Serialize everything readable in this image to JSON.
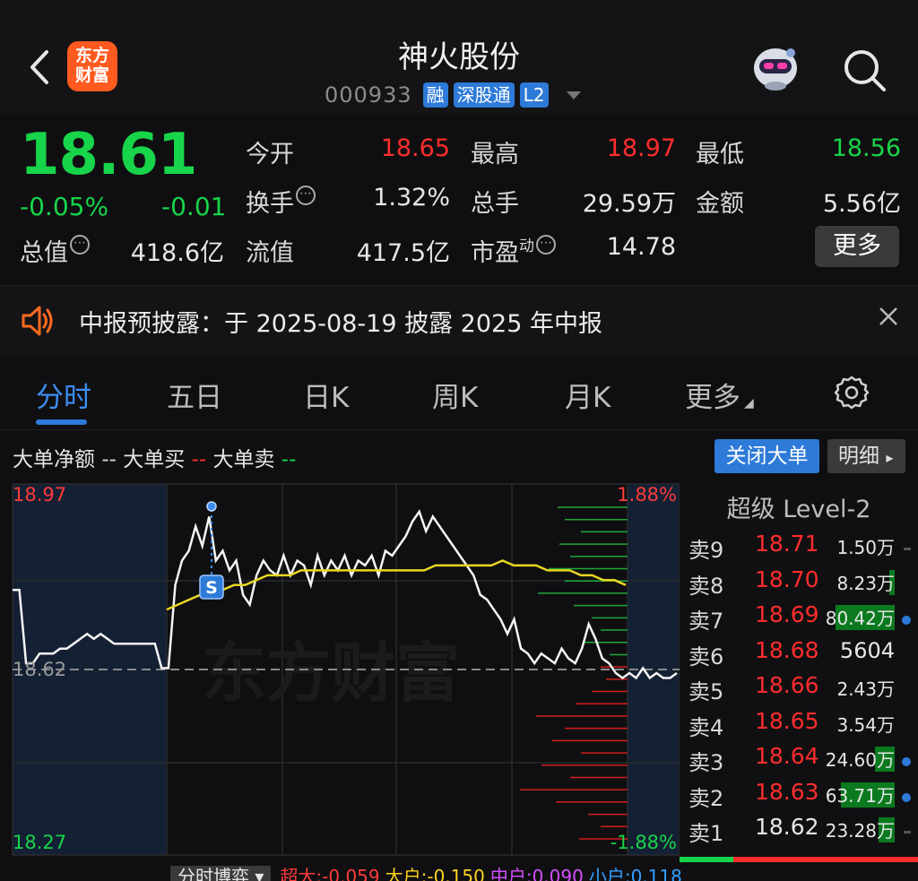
{
  "header": {
    "title": "神火股份",
    "logo_text_1": "东方",
    "logo_text_2": "财富",
    "code": "000933",
    "tags": [
      "融",
      "深股通",
      "L2"
    ]
  },
  "quote": {
    "price": "18.61",
    "change_pct": "-0.05%",
    "change": "-0.01",
    "stats": [
      {
        "label": "今开",
        "value": "18.65",
        "color": "up"
      },
      {
        "label": "最高",
        "value": "18.97",
        "color": "up"
      },
      {
        "label": "最低",
        "value": "18.56",
        "color": "down"
      },
      {
        "label": "换手",
        "value": "1.32%",
        "color": "plain"
      },
      {
        "label": "总手",
        "value": "29.59万",
        "color": "plain"
      },
      {
        "label": "金额",
        "value": "5.56亿",
        "color": "plain"
      },
      {
        "label": "总值",
        "value": "418.6亿",
        "color": "plain"
      },
      {
        "label": "流值",
        "value": "417.5亿",
        "color": "plain"
      },
      {
        "label": "市盈",
        "label_sup": "动",
        "value": "14.78",
        "color": "plain"
      }
    ],
    "more_label": "更多",
    "info_glyph": "⋯"
  },
  "notice": {
    "text": "中报预披露：于 2025-08-19 披露 2025 年中报"
  },
  "tabs": [
    {
      "label": "分时",
      "active": true
    },
    {
      "label": "五日"
    },
    {
      "label": "日K"
    },
    {
      "label": "周K"
    },
    {
      "label": "月K"
    },
    {
      "label": "更多"
    }
  ],
  "legend": {
    "net_label": "大单净额",
    "net_marker": "--",
    "buy_label": "大单买",
    "buy_marker": "--",
    "sell_label": "大单卖",
    "sell_marker": "--",
    "close_button": "关闭大单",
    "detail_button": "明细",
    "detail_arrow": "▸"
  },
  "chart_data": {
    "type": "line",
    "price_high_label": "18.97",
    "price_ref_label": "18.62",
    "price_low_label": "18.27",
    "pct_high_label": "1.88%",
    "pct_low_label": "-1.88%",
    "watermark": "东方财富",
    "signal_label": "S",
    "ylim": [
      18.27,
      18.97
    ],
    "ref_price": 18.62,
    "price_series": [
      18.79,
      18.79,
      18.64,
      18.64,
      18.66,
      18.66,
      18.66,
      18.67,
      18.67,
      18.68,
      18.69,
      18.7,
      18.69,
      18.7,
      18.69,
      18.68,
      18.68,
      18.68,
      18.68,
      18.68,
      18.68,
      18.68,
      18.63,
      18.63,
      18.8,
      18.85,
      18.87,
      18.92,
      18.88,
      18.94,
      18.85,
      18.87,
      18.83,
      18.85,
      18.78,
      18.76,
      18.82,
      18.85,
      18.83,
      18.82,
      18.86,
      18.82,
      18.85,
      18.84,
      18.8,
      18.86,
      18.82,
      18.85,
      18.83,
      18.86,
      18.82,
      18.85,
      18.84,
      18.86,
      18.82,
      18.87,
      18.86,
      18.88,
      18.9,
      18.93,
      18.95,
      18.91,
      18.94,
      18.92,
      18.9,
      18.88,
      18.86,
      18.84,
      18.82,
      18.78,
      18.77,
      18.75,
      18.73,
      18.7,
      18.73,
      18.67,
      18.66,
      18.64,
      18.66,
      18.65,
      18.64,
      18.67,
      18.65,
      18.64,
      18.67,
      18.72,
      18.69,
      18.65,
      18.64,
      18.62,
      18.61,
      18.62,
      18.61,
      18.63,
      18.61,
      18.62,
      18.61,
      18.61,
      18.62
    ],
    "avg_series": [
      18.75,
      18.76,
      18.77,
      18.78,
      18.79,
      18.79,
      18.8,
      18.8,
      18.81,
      18.82,
      18.82,
      18.82,
      18.83,
      18.83,
      18.83,
      18.83,
      18.83,
      18.83,
      18.83,
      18.83,
      18.83,
      18.83,
      18.83,
      18.83,
      18.84,
      18.84,
      18.84,
      18.84,
      18.84,
      18.84,
      18.85,
      18.84,
      18.84,
      18.84,
      18.83,
      18.83,
      18.83,
      18.82,
      18.82,
      18.81,
      18.81,
      18.8
    ],
    "big_order_ladder": [
      {
        "side": "buy",
        "len": 78
      },
      {
        "side": "buy",
        "len": 70
      },
      {
        "side": "buy",
        "len": 52
      },
      {
        "side": "buy",
        "len": 76
      },
      {
        "side": "buy",
        "len": 64
      },
      {
        "side": "buy",
        "len": 88
      },
      {
        "side": "buy",
        "len": 70
      },
      {
        "side": "buy",
        "len": 100
      },
      {
        "side": "buy",
        "len": 60
      },
      {
        "side": "buy",
        "len": 40
      },
      {
        "side": "buy",
        "len": 30
      },
      {
        "side": "buy",
        "len": 48
      },
      {
        "side": "buy",
        "len": 20
      },
      {
        "side": "sell",
        "len": 30
      },
      {
        "side": "sell",
        "len": 24
      },
      {
        "side": "sell",
        "len": 40
      },
      {
        "side": "sell",
        "len": 58
      },
      {
        "side": "sell",
        "len": 102
      },
      {
        "side": "sell",
        "len": 70
      },
      {
        "side": "sell",
        "len": 84
      },
      {
        "side": "sell",
        "len": 52
      },
      {
        "side": "sell",
        "len": 96
      },
      {
        "side": "sell",
        "len": 64
      },
      {
        "side": "sell",
        "len": 120
      },
      {
        "side": "sell",
        "len": 80
      },
      {
        "side": "sell",
        "len": 44
      },
      {
        "side": "sell",
        "len": 30
      },
      {
        "side": "sell",
        "len": 54
      }
    ]
  },
  "orderbook": {
    "title": "超级 Level-2",
    "rows": [
      {
        "label": "卖9",
        "price": "18.71",
        "vol": "1.50万",
        "bar": 0,
        "marker": "dash",
        "price_color": "up"
      },
      {
        "label": "卖8",
        "price": "18.70",
        "vol": "8.23万",
        "bar": 6,
        "marker": "none",
        "price_color": "up"
      },
      {
        "label": "卖7",
        "price": "18.69",
        "vol": "80.42万",
        "bar": 66,
        "marker": "dot",
        "price_color": "up"
      },
      {
        "label": "卖6",
        "price": "18.68",
        "vol": "5604",
        "bar": 0,
        "marker": "none",
        "price_color": "up"
      },
      {
        "label": "卖5",
        "price": "18.66",
        "vol": "2.43万",
        "bar": 0,
        "marker": "none",
        "price_color": "up"
      },
      {
        "label": "卖4",
        "price": "18.65",
        "vol": "3.54万",
        "bar": 0,
        "marker": "none",
        "price_color": "up"
      },
      {
        "label": "卖3",
        "price": "18.64",
        "vol": "24.60万",
        "bar": 22,
        "marker": "dot",
        "price_color": "up"
      },
      {
        "label": "卖2",
        "price": "18.63",
        "vol": "63.71万",
        "bar": 60,
        "marker": "dot",
        "price_color": "up"
      },
      {
        "label": "卖1",
        "price": "18.62",
        "vol": "23.28万",
        "bar": 18,
        "marker": "dash",
        "price_color": "plain"
      }
    ]
  },
  "bottom_bar": {
    "label": "分时博弈",
    "items": [
      {
        "name": "超大",
        "value": "-0.059",
        "color": "#ff3b3b"
      },
      {
        "name": "大户",
        "value": "-0.150",
        "color": "#ffd21f"
      },
      {
        "name": "中户",
        "value": "0.090",
        "color": "#d34fff"
      },
      {
        "name": "小户",
        "value": "0.118",
        "color": "#33a0ff"
      }
    ]
  }
}
